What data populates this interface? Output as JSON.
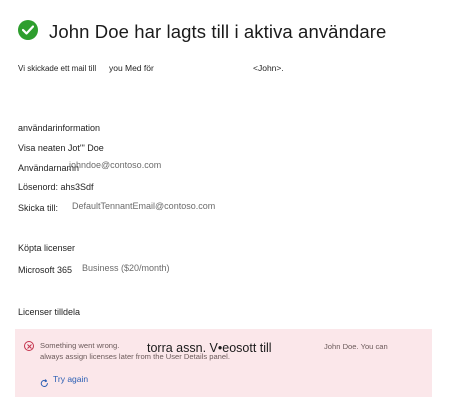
{
  "header": {
    "icon": "success-check-icon",
    "title": "John Doe har lagts till i aktiva användare"
  },
  "mail_notice": {
    "prefix": "Vi skickade ett mail till",
    "you": "you",
    "med_for": "Med för",
    "recipient": "<John>."
  },
  "user_info": {
    "heading": "användarinformation",
    "display_name_label": "Visa neaten Jot'\" Doe",
    "username_label": "Användarnamn",
    "username_value": "johndoe@contoso.com",
    "password_label": "Lösenord: ahs3Sdf",
    "send_to_label": "Skicka till:",
    "send_to_value": "DefaultTennantEmail@contoso.com"
  },
  "licenses": {
    "heading": "Köpta licenser",
    "product_name": "Microsoft 365",
    "product_plan": "Business ($20/month)",
    "assigned_heading": "Licenser tilldela"
  },
  "error": {
    "icon": "error-circle-icon",
    "line1_prefix": "Something went wrong.",
    "overlay_text": "torra assn. V•eosott till",
    "line1_suffix": "John Doe. You can",
    "line2": "always assign licenses later from the User Details panel.",
    "retry_icon": "refresh-icon",
    "retry_label": "Try again",
    "colors": {
      "background": "#fbe7ea",
      "icon": "#c4314b",
      "link": "#2b5fb4"
    }
  },
  "colors": {
    "success": "#2e9e2e"
  }
}
